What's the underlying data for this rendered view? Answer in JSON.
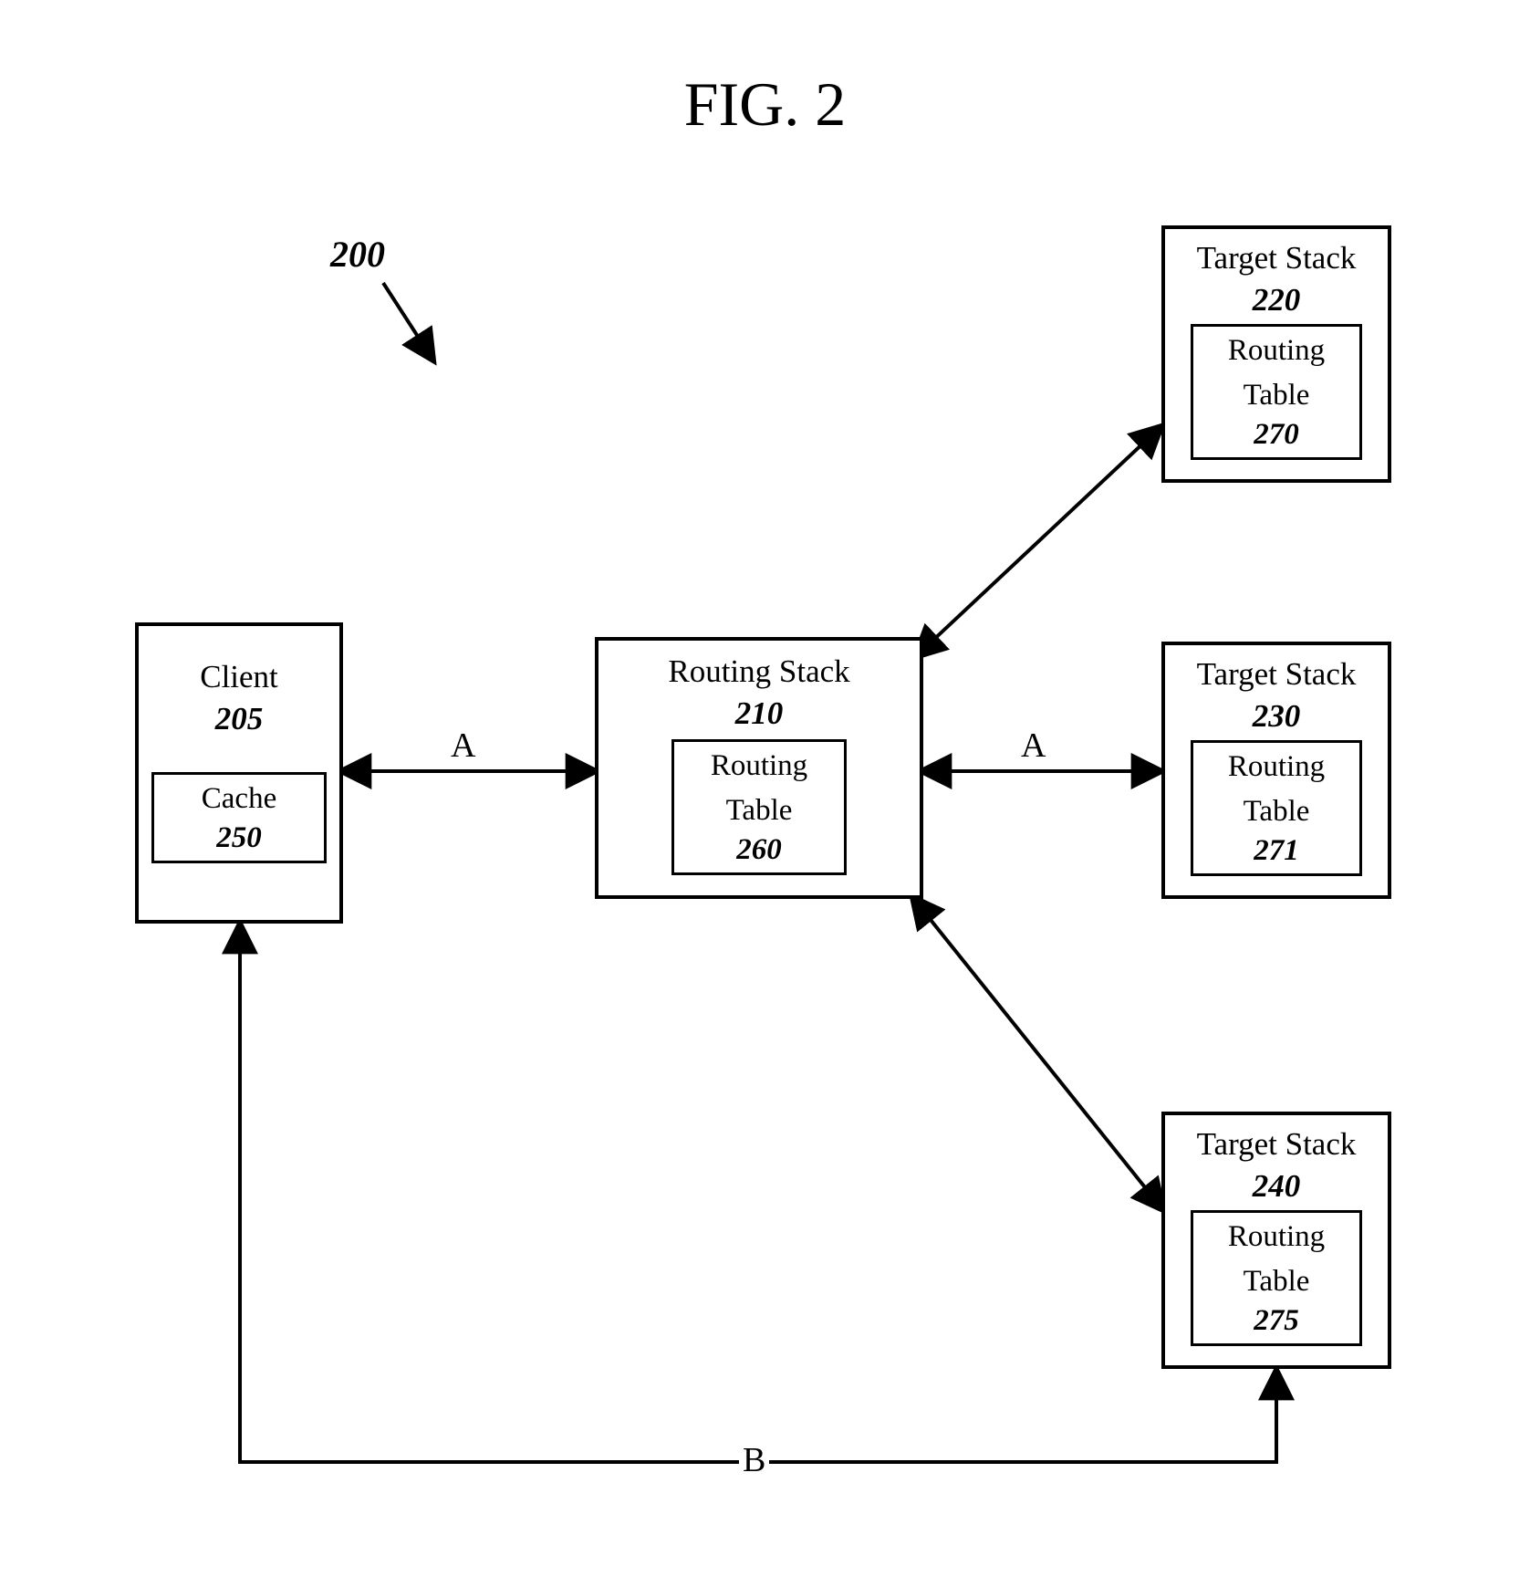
{
  "title": "FIG. 2",
  "ref200": "200",
  "client": {
    "label": "Client",
    "num": "205",
    "inner_label": "Cache",
    "inner_num": "250"
  },
  "routing": {
    "label": "Routing Stack",
    "num": "210",
    "inner_label": "Routing Table",
    "inner_num": "260"
  },
  "t1": {
    "label": "Target Stack",
    "num": "220",
    "inner_label": "Routing Table",
    "inner_num": "270"
  },
  "t2": {
    "label": "Target Stack",
    "num": "230",
    "inner_label": "Routing Table",
    "inner_num": "271"
  },
  "t3": {
    "label": "Target Stack",
    "num": "240",
    "inner_label": "Routing Table",
    "inner_num": "275"
  },
  "edgeA": "A",
  "edgeB": "B"
}
